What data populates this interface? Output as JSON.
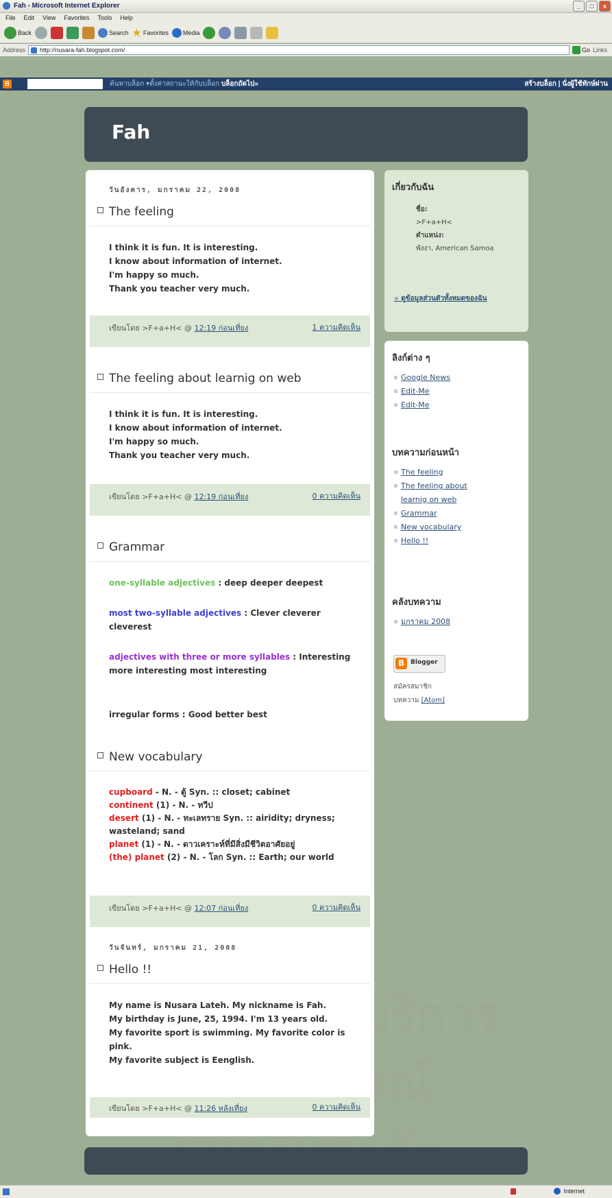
{
  "browser": {
    "title": "Fah - Microsoft Internet Explorer",
    "menu": [
      "File",
      "Edit",
      "View",
      "Favorites",
      "Tools",
      "Help"
    ],
    "toolbar": {
      "back": "Back",
      "search": "Search",
      "favorites": "Favorites",
      "media": "Media"
    },
    "address_label": "Address",
    "address": "http://nusara-fah.blogspot.com/",
    "go": "Go",
    "links": "Links",
    "status_zone": "Internet"
  },
  "navbar": {
    "links_text": "ค้นหาบล็อก  ▾ตั้งค่าสถานะให้กับบล็อก",
    "next_blog": "บล็อกถัดไป»",
    "right": "สร้างบล็อก | นั่งผู้ใช้ทักษ์ผ่าน"
  },
  "blog": {
    "title": "Fah"
  },
  "dates": [
    "วันอังคาร, มกราคม 22, 2008",
    "วันจันทร์, มกราคม 21, 2008"
  ],
  "posts": [
    {
      "title": "The feeling",
      "lines": [
        "I think it is fun. It is interesting.",
        "I know about information of internet.",
        "I'm happy so much.",
        "Thank you teacher very much."
      ],
      "by": "เขียนโดย >F+a+H< @",
      "time": "12:19 ก่อนเที่ยง",
      "comments": "1 ความคิดเห็น"
    },
    {
      "title": "The feeling about learnig on web",
      "lines": [
        "I think it is fun. It is interesting.",
        "I know about information of internet.",
        "I'm happy so much.",
        "Thank you teacher very much."
      ],
      "by": "เขียนโดย >F+a+H< @",
      "time": "12:19 ก่อนเที่ยง",
      "comments": "0 ความคิดเห็น"
    },
    {
      "title": "Grammar",
      "g1_label": "one-syllable adjectives",
      "g1_text": " : deep deeper deepest",
      "g2_label": "most two-syllable adjectives",
      "g2_text": " : Clever cleverer cleverest",
      "g3_label": "adjectives with three or more syllables",
      "g3_text": " : Interesting more interesting most interesting",
      "g4_text": "irregular forms : Good better best"
    },
    {
      "title": "New vocabulary",
      "v1_word": "cupboard",
      "v1_text": " - N. - ตู้ Syn. :: closet; cabinet",
      "v2_word": "continent",
      "v2_text": " (1) - N. - ทวีป",
      "v3_word": "desert",
      "v3_text": " (1) - N. - ทะเลทราย Syn. :: airidity; dryness; wasteland; sand",
      "v4_word": "planet",
      "v4_text": " (1) - N. - ดาวเคราะห์ที่มีสิ่งมีชีวิตอาศัยอยู่",
      "v5_word": "(the) planet",
      "v5_text": " (2) - N. - โลก Syn. :: Earth; our world",
      "by": "เขียนโดย >F+a+H< @",
      "time": "12:07 ก่อนเที่ยง",
      "comments": "0 ความคิดเห็น"
    },
    {
      "title": "Hello !!",
      "lines": [
        "My name is Nusara Lateh. My nickname is Fah.",
        "My birthday is June, 25, 1994. I'm 13 years old.",
        "My favorite sport is swimming. My favorite color is",
        "pink.",
        "My favorite subject is Eenglish."
      ],
      "by": "เขียนโดย >F+a+H< @",
      "time": "11:26 หลังเที่ยง",
      "comments": "0 ความคิดเห็น"
    }
  ],
  "sidebar": {
    "about": {
      "heading": "เกี่ยวกับฉัน",
      "name_label": "ชื่อ:",
      "name": ">F+a+H<",
      "location_label": "ตำแหน่ง:",
      "location": "พังงา, American Samoa",
      "profile_link": "ดูข้อมูลส่วนตัวทั้งหมดของฉัน"
    },
    "links_heading": "ลิงก์ต่าง ๆ",
    "links": [
      "Google News",
      "Edit-Me",
      "Edit-Me"
    ],
    "prev_heading": "บทความก่อนหน้า",
    "prev": [
      "The feeling",
      "The feeling about learnig on web",
      "Grammar",
      "New vocabulary",
      "Hello !!"
    ],
    "archive_heading": "คลังบทความ",
    "archive": [
      "มกราคม 2008"
    ],
    "powered": "Blogger",
    "subscribe": "สมัครสมาชิก",
    "posts_label": "บทความ",
    "atom": "[Atom]"
  },
  "watermark": "สถาบันวิทยบริการ จุฬาลงกรณ์มหาวิทยาลัย"
}
